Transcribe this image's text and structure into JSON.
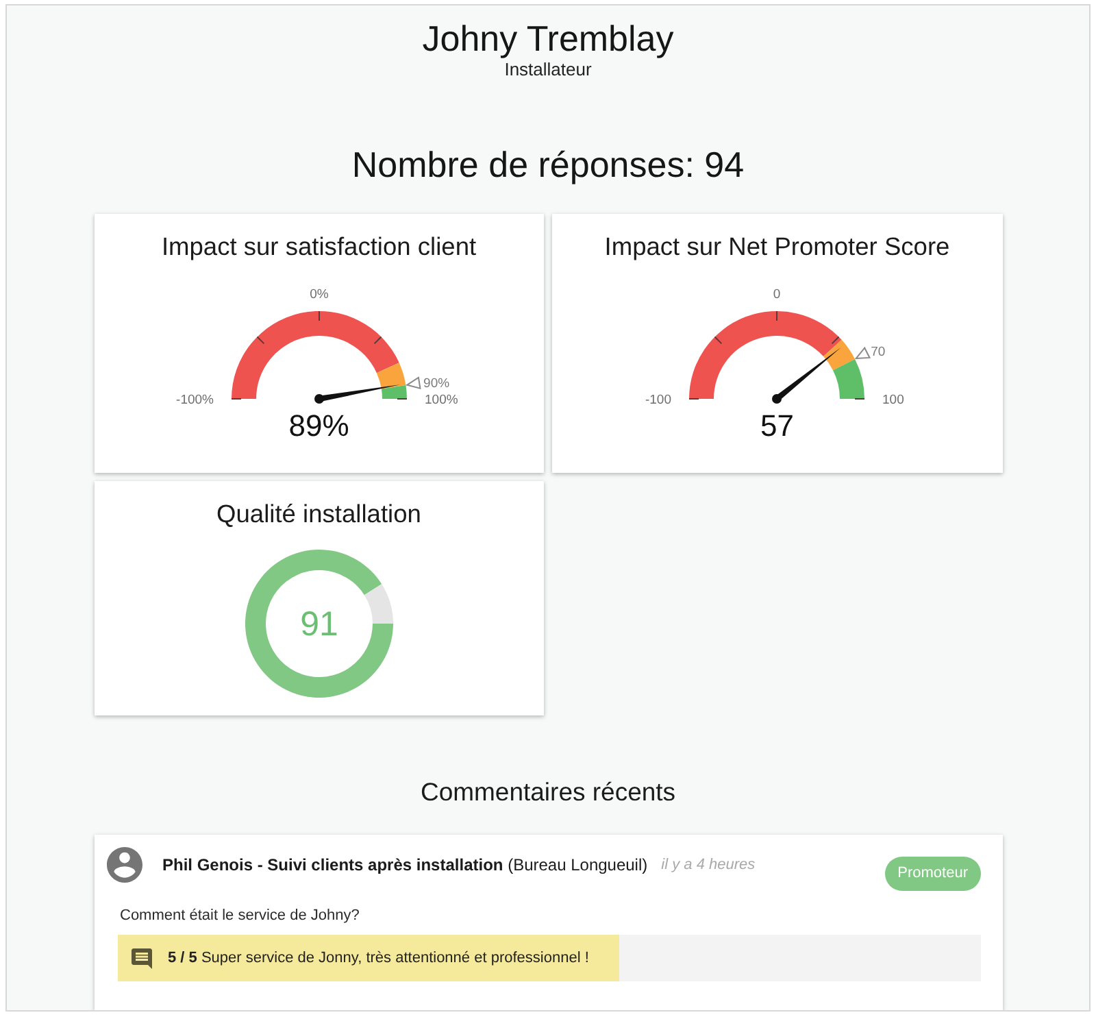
{
  "header": {
    "name": "Johny Tremblay",
    "role": "Installateur"
  },
  "responses": {
    "label": "Nombre de réponses: 94"
  },
  "gauges": [
    {
      "title": "Impact sur satisfaction client",
      "value": "89%",
      "scale": {
        "min": "-100%",
        "mid": "0%",
        "max": "100%"
      },
      "target": {
        "label": "90%"
      },
      "bands": [
        {
          "color": "#ef5350"
        },
        {
          "color": "#f9a43c"
        },
        {
          "color": "#5fbf69"
        }
      ]
    },
    {
      "title": "Impact sur Net Promoter Score",
      "value": "57",
      "scale": {
        "min": "-100",
        "mid": "0",
        "max": "100"
      },
      "target": {
        "label": "70"
      },
      "bands": [
        {
          "color": "#ef5350"
        },
        {
          "color": "#f9a43c"
        },
        {
          "color": "#5fbf69"
        }
      ]
    }
  ],
  "quality": {
    "title": "Qualité installation",
    "value": "91",
    "chart_data": {
      "type": "donut",
      "values": [
        91,
        9
      ]
    }
  },
  "comments": {
    "title": "Commentaires récents",
    "items": [
      {
        "author": "**Phil Genois - Suivi clients après installation** (Bureau Longueuil)",
        "time": "il y a 4 heures",
        "badge": {
          "label": "Promoteur",
          "color": "#80c883"
        },
        "question": "Comment était le service de Johny?",
        "answer": "**5 / 5** Super service de Jonny, très attentionné et professionnel !"
      }
    ]
  }
}
